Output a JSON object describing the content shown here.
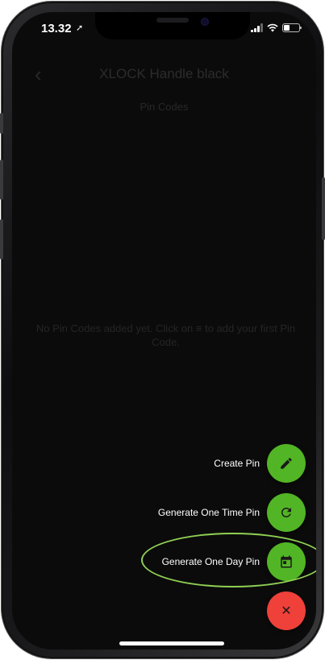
{
  "status_bar": {
    "time": "13.32",
    "location_arrow": "➚"
  },
  "header": {
    "back_icon": "chevron-left-icon",
    "back_glyph": "‹",
    "title": "XLOCK Handle black"
  },
  "subtitle": "Pin Codes",
  "empty_state": {
    "text_before": "No Pin Codes added yet. Click on",
    "menu_glyph": "≡",
    "text_after": "to add your first Pin Code."
  },
  "fab_menu": {
    "items": [
      {
        "label": "Create Pin",
        "icon": "pencil-icon"
      },
      {
        "label": "Generate One Time Pin",
        "icon": "refresh-icon"
      },
      {
        "label": "Generate One Day Pin",
        "icon": "calendar-icon"
      }
    ],
    "close_icon": "close-icon",
    "close_glyph": "✕"
  },
  "colors": {
    "fab_green": "#52b525",
    "fab_red": "#f0403a",
    "highlight_outline": "#8fd053",
    "screen_background": "#0b0b0b"
  }
}
